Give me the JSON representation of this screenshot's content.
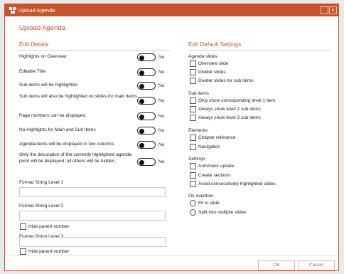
{
  "window": {
    "title": "Upload Agenda"
  },
  "heading": "Upload Agenda",
  "left": {
    "section_title": "Edit Details",
    "rows": [
      {
        "label": "Highlights on Overview",
        "state": "No"
      },
      {
        "label": "Editable Title",
        "state": "No"
      },
      {
        "label": "Sub items will be highlighted",
        "state": "No"
      },
      {
        "label": "Sub items will also be highlighted on slides for main items",
        "state": "No"
      },
      {
        "label": "Page numbers can be displayed",
        "state": "No"
      },
      {
        "label": "No Highlights for Main and Sub Items",
        "state": "No"
      },
      {
        "label": "Agenda items will be displayed in two columns",
        "state": "No"
      },
      {
        "label": "Only the decoration of the currently highlighted agenda point will be displayed, all others will be hidden.",
        "state": "No"
      }
    ],
    "format_level1": {
      "label": "Format String Level 1",
      "value": ""
    },
    "format_level2": {
      "label": "Format String Level 2",
      "value": "",
      "hide_parent": "Hide parent number"
    },
    "format_level3": {
      "label": "Format String Level 3",
      "value": "",
      "hide_parent": "Hide parent number"
    }
  },
  "right": {
    "section_title": "Edit Default Settings",
    "agenda_slides": {
      "title": "Agenda slides",
      "items": [
        "Overview slide",
        "Divider slides",
        "Divider slides for sub items"
      ]
    },
    "sub_items": {
      "title": "Sub items",
      "items": [
        "Only show corresponding level 1 item",
        "Always show level 2 sub items",
        "Always show level 3 sub items"
      ]
    },
    "elements": {
      "title": "Elements",
      "items": [
        "Chapter reference",
        "Navigation"
      ]
    },
    "settings": {
      "title": "Settings",
      "items": [
        "Automatic update",
        "Create sections",
        "Avoid consecutively highlighted slides"
      ]
    },
    "overflow": {
      "title": "On overflow",
      "items": [
        "Fit to slide",
        "Split into multiple slides"
      ]
    }
  },
  "footer": {
    "ok": "OK",
    "cancel": "Cancel"
  },
  "colors": {
    "accent": "#c9532c"
  }
}
